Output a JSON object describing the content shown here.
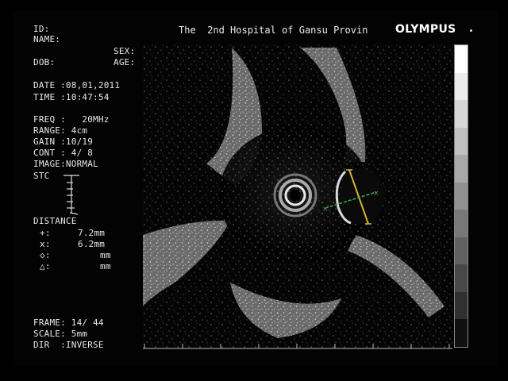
{
  "header": {
    "hospital": "The  2nd Hospital of Gansu Provin",
    "brand": "OLYMPUS"
  },
  "patient": {
    "id_label": "ID:",
    "name_label": "NAME:",
    "sex_label": "SEX:",
    "dob_label": "DOB:",
    "age_label": "AGE:"
  },
  "session": {
    "date": "DATE :08,01,2011",
    "time": "TIME :10:47:54"
  },
  "settings": {
    "freq": "FREQ :   20MHz",
    "range": "RANGE: 4cm",
    "gain": "GAIN :10/19",
    "cont": "CONT : 4/ 8",
    "image": "IMAGE:NORMAL",
    "stc": "STC"
  },
  "distance": {
    "title": "DISTANCE",
    "rows": [
      {
        "symbol": "+:",
        "value": "7.2mm"
      },
      {
        "symbol": "x:",
        "value": "6.2mm"
      },
      {
        "symbol": "◇:",
        "value": "mm"
      },
      {
        "symbol": "△:",
        "value": "mm"
      }
    ]
  },
  "footer": {
    "frame": "FRAME: 14/ 44",
    "scale": "SCALE: 5mm",
    "dir": "DIR  :INVERSE"
  },
  "colors": {
    "background": "#000000",
    "text": "#e9e9e9",
    "caliper_plus": "#d6b23a",
    "caliper_x": "#3fa34a"
  }
}
